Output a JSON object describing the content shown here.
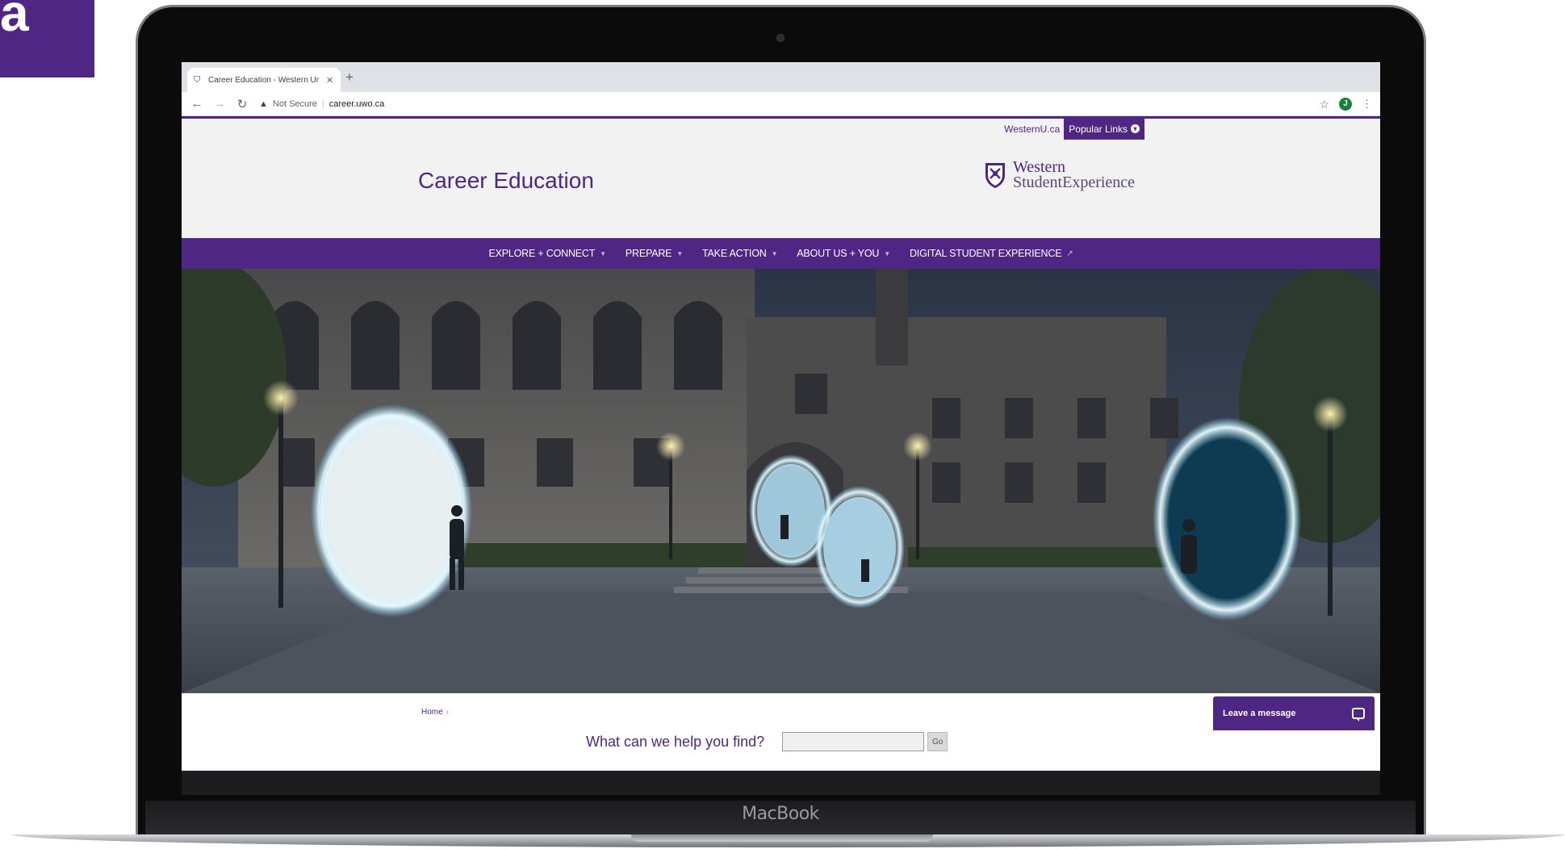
{
  "corner_badge": {
    "text": "a"
  },
  "device": {
    "label": "MacBook"
  },
  "browser": {
    "tab_title": "Career Education - Western Ur",
    "new_tab_symbol": "+",
    "security_label": "Not Secure",
    "url": "career.uwo.ca",
    "profile_initial": "J"
  },
  "utility": {
    "westernu_link": "WesternU.ca",
    "popular_links": "Popular Links"
  },
  "site": {
    "title": "Career Education",
    "brand_line1": "Western",
    "brand_line2": "StudentExperience"
  },
  "nav": {
    "items": [
      {
        "label": "EXPLORE + CONNECT",
        "has_dropdown": true
      },
      {
        "label": "PREPARE",
        "has_dropdown": true
      },
      {
        "label": "TAKE ACTION",
        "has_dropdown": true
      },
      {
        "label": "ABOUT US + YOU",
        "has_dropdown": true
      },
      {
        "label": "DIGITAL STUDENT EXPERIENCE",
        "external": true
      }
    ]
  },
  "breadcrumb": {
    "home": "Home",
    "separator": "›"
  },
  "search": {
    "prompt": "What can we help you find?",
    "value": "",
    "button": "Go"
  },
  "chat": {
    "label": "Leave a message"
  },
  "colors": {
    "brand_purple": "#4f2683",
    "page_bg": "#f2f2f2",
    "footer_dark": "#1d1d1f"
  }
}
